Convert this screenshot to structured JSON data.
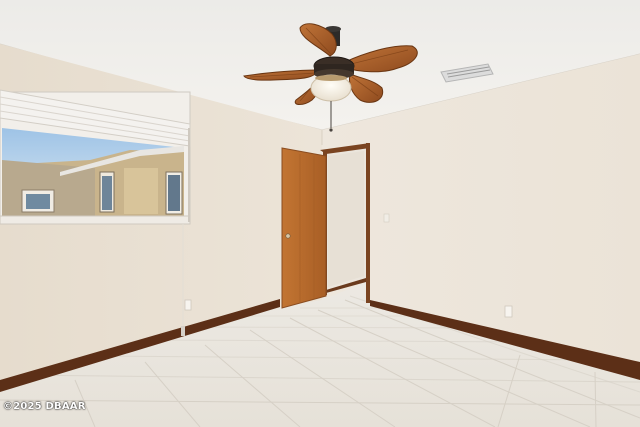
{
  "watermark": {
    "text": "©2025 DBAAR"
  },
  "colors": {
    "ceiling": "#f1efec",
    "wall_left": "#e5ddd0",
    "wall_right": "#ede6dc",
    "baseboard": "#5e3018",
    "door": "#b86a2e",
    "floor_tile": "#e9e5de",
    "fan_blade": "#a85c2a"
  }
}
